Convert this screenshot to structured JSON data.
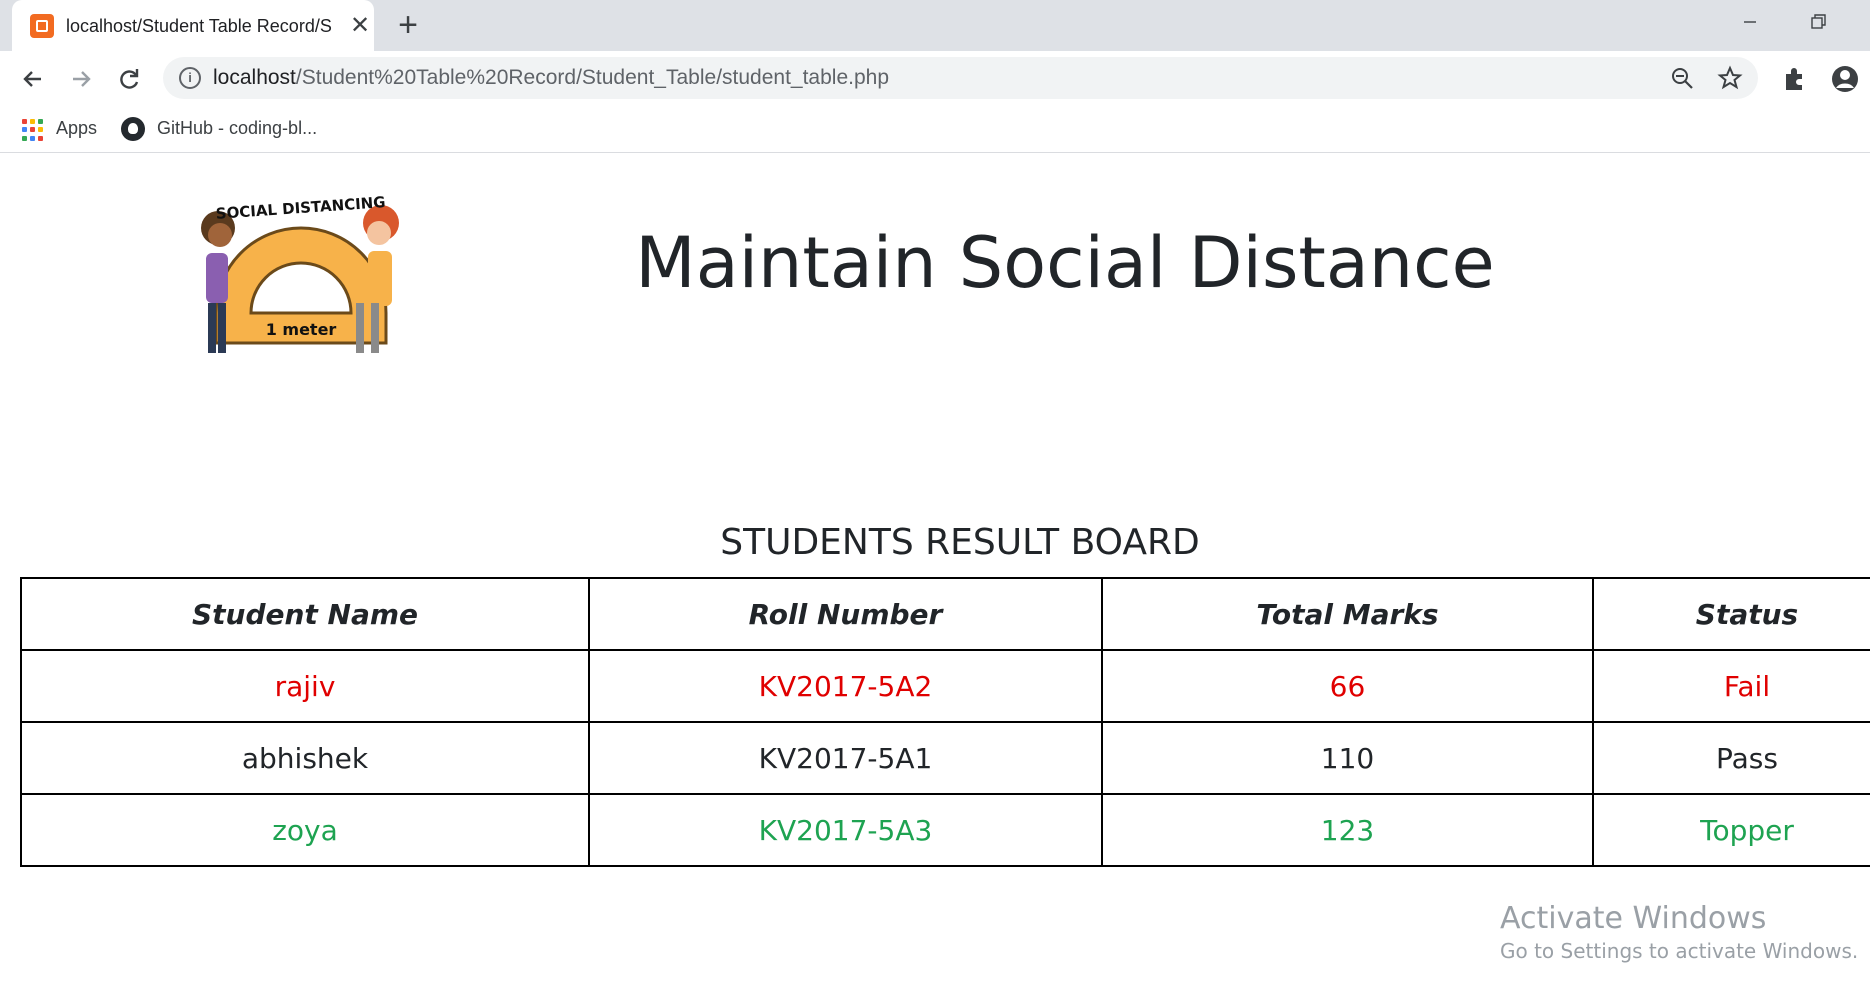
{
  "browser": {
    "tab_title": "localhost/Student Table Record/S",
    "tab_close": "✕",
    "new_tab": "+",
    "url_host": "localhost",
    "url_path": "/Student%20Table%20Record/Student_Table/student_table.php",
    "bookmarks": [
      {
        "label": "Apps",
        "icon": "apps-grid-icon"
      },
      {
        "label": "GitHub - coding-bl...",
        "icon": "github-icon"
      }
    ]
  },
  "page": {
    "logo": {
      "top_text": "SOCIAL DISTANCING",
      "bottom_text": "1 meter"
    },
    "heading": "Maintain Social Distance",
    "board_title": "STUDENTS RESULT BOARD",
    "table": {
      "headers": [
        "Student Name",
        "Roll Number",
        "Total Marks",
        "Status"
      ],
      "rows": [
        {
          "name": "rajiv",
          "roll": "KV2017-5A2",
          "marks": "66",
          "status": "Fail",
          "color": "#e00000"
        },
        {
          "name": "abhishek",
          "roll": "KV2017-5A1",
          "marks": "110",
          "status": "Pass",
          "color": "#212529"
        },
        {
          "name": "zoya",
          "roll": "KV2017-5A3",
          "marks": "123",
          "status": "Topper",
          "color": "#1ea351"
        }
      ]
    }
  },
  "watermark": {
    "title": "Activate Windows",
    "subtitle": "Go to Settings to activate Windows."
  },
  "colors": {
    "tabstrip": "#dee1e6",
    "fail": "#e00000",
    "topper": "#1ea351",
    "xampp_orange": "#f26b21"
  }
}
